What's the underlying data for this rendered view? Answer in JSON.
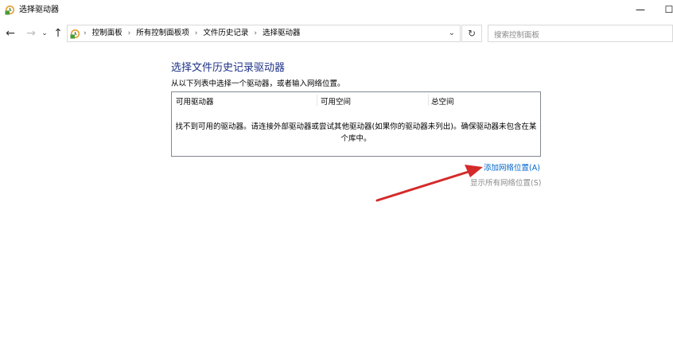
{
  "window": {
    "title": "选择驱动器",
    "minimize_glyph": "—",
    "maximize_glyph": "☐"
  },
  "nav": {
    "back_glyph": "←",
    "forward_glyph": "→",
    "recent_glyph": "⌄",
    "up_glyph": "↑",
    "breadcrumbs": [
      "控制面板",
      "所有控制面板项",
      "文件历史记录",
      "选择驱动器"
    ],
    "separator": "›",
    "dropdown_glyph": "⌄",
    "refresh_glyph": "↻",
    "search_placeholder": "搜索控制面板"
  },
  "content": {
    "heading": "选择文件历史记录驱动器",
    "instruction": "从以下列表中选择一个驱动器，或者输入网络位置。",
    "columns": [
      "可用驱动器",
      "可用空间",
      "总空间"
    ],
    "empty_message_line1": "找不到可用的驱动器。请连接外部驱动器或尝试其他驱动器(如果你的驱动器未列出)。确保驱动器未包含在某",
    "empty_message_line2": "个库中。",
    "add_network_link": "添加网络位置(A)",
    "show_all_network_link": "显示所有网络位置(S)"
  },
  "icons": {
    "app": "file-history-icon",
    "arrow_annotation": "red-arrow"
  },
  "colors": {
    "heading": "#1e3287",
    "link": "#0066cc",
    "disabled_link": "#8c8c8c",
    "annotation_arrow": "#d42a2a"
  }
}
